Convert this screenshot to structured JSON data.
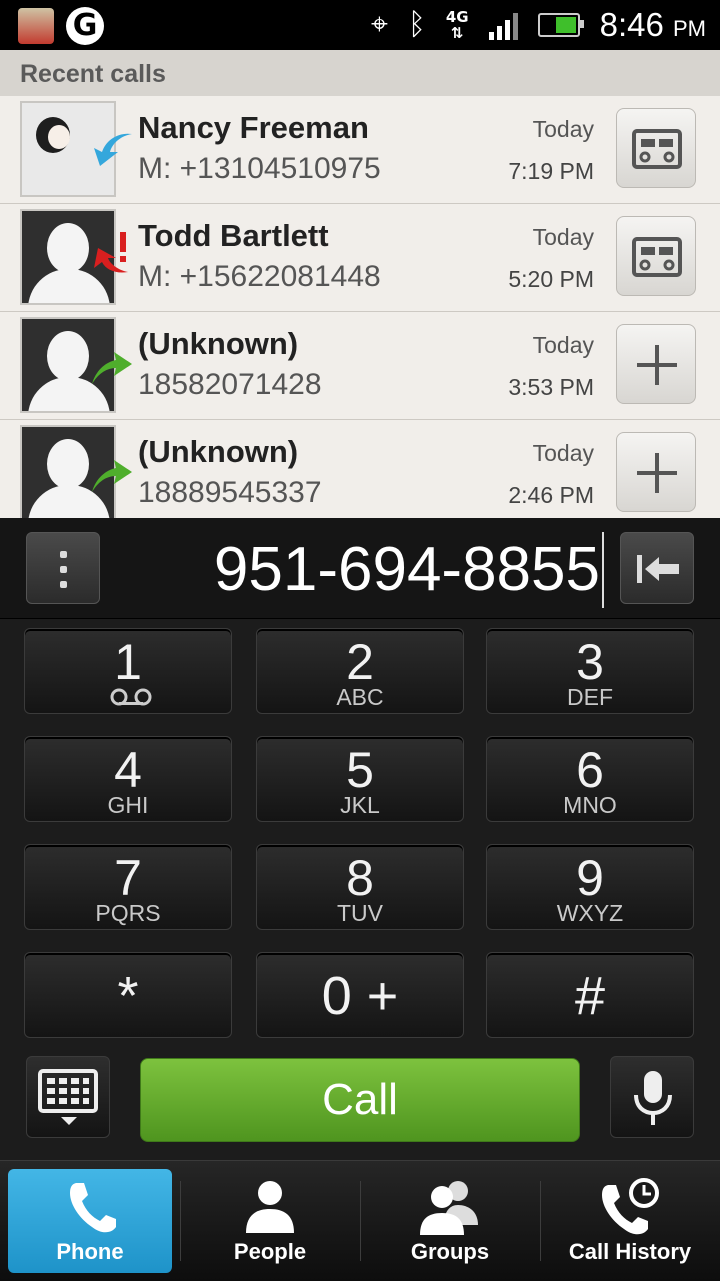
{
  "status_bar": {
    "icons": [
      "notification-app-icon",
      "g-app-icon",
      "gps-icon",
      "bluetooth-icon",
      "network-4g-icon",
      "signal-icon",
      "battery-icon"
    ],
    "network_label": "4G",
    "signal_level": 0.75,
    "battery_level": 0.6,
    "time": "8:46",
    "time_suffix": "PM"
  },
  "recent_calls": {
    "header": "Recent calls",
    "items": [
      {
        "name": "Nancy Freeman",
        "number": "M: +13104510975",
        "day": "Today",
        "time": "7:19 PM",
        "type": "incoming",
        "action": "contact-card"
      },
      {
        "name": "Todd Bartlett",
        "number": "M: +15622081448",
        "day": "Today",
        "time": "5:20 PM",
        "type": "missed",
        "action": "contact-card"
      },
      {
        "name": "(Unknown)",
        "number": "18582071428",
        "day": "Today",
        "time": "3:53 PM",
        "type": "outgoing",
        "action": "add-contact"
      },
      {
        "name": "(Unknown)",
        "number": "18889545337",
        "day": "Today",
        "time": "2:46 PM",
        "type": "outgoing",
        "action": "add-contact"
      }
    ]
  },
  "dialer": {
    "number": "951-694-8855",
    "keys": [
      {
        "digit": "1",
        "letters": ""
      },
      {
        "digit": "2",
        "letters": "ABC"
      },
      {
        "digit": "3",
        "letters": "DEF"
      },
      {
        "digit": "4",
        "letters": "GHI"
      },
      {
        "digit": "5",
        "letters": "JKL"
      },
      {
        "digit": "6",
        "letters": "MNO"
      },
      {
        "digit": "7",
        "letters": "PQRS"
      },
      {
        "digit": "8",
        "letters": "TUV"
      },
      {
        "digit": "9",
        "letters": "WXYZ"
      },
      {
        "digit": "*",
        "letters": ""
      },
      {
        "digit": "0 +",
        "letters": ""
      },
      {
        "digit": "#",
        "letters": ""
      }
    ],
    "call_label": "Call"
  },
  "tabs": [
    {
      "label": "Phone",
      "icon": "phone-icon",
      "active": true
    },
    {
      "label": "People",
      "icon": "person-icon",
      "active": false
    },
    {
      "label": "Groups",
      "icon": "group-icon",
      "active": false
    },
    {
      "label": "Call History",
      "icon": "call-history-icon",
      "active": false
    }
  ],
  "colors": {
    "accent": "#2fa6da",
    "call_green": "#6ab332",
    "incoming_arrow": "#34a7dc",
    "missed_arrow": "#d91f1f",
    "outgoing_arrow": "#4fae2c"
  }
}
